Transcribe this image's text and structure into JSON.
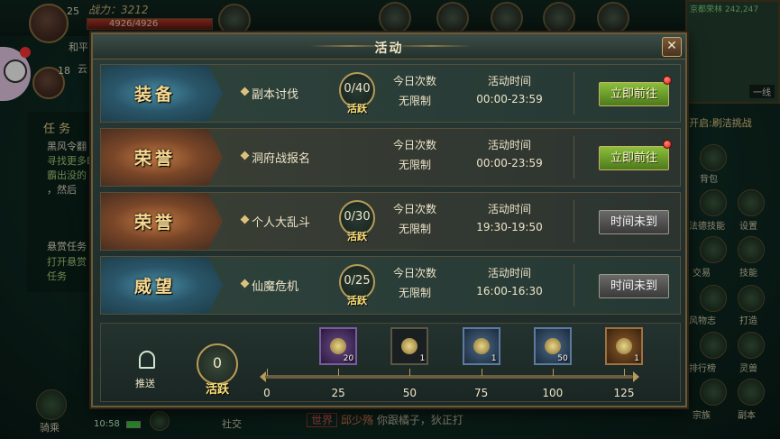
{
  "hud": {
    "player_level": "25",
    "companion_level": "18",
    "power_label": "战力：3212",
    "hp_text": "4926/4926",
    "player_name_partial": "和平",
    "companion_name_partial": "云",
    "minimap_title": "京都荣林 242,247",
    "minimap_line": "一线",
    "task_tab": "任 务",
    "task_1": "黑风令翻",
    "task_2": "寻找更多B",
    "task_3": "霸出没的",
    "task_4": "，然后",
    "task_5": "悬赏任务",
    "task_6": "打开悬赏",
    "task_7": "任务",
    "next_open": "开启:刷洁挑战",
    "side_labels": [
      "背包",
      "法德技能",
      "设置",
      "交易",
      "技能",
      "风物志",
      "打造",
      "排行榜",
      "灵兽",
      "宗族",
      "副本"
    ],
    "bottom_labels": [
      "骑乘",
      "社交"
    ],
    "clock": "10:58",
    "chat_channel": "世界",
    "chat_name": "邱少殇",
    "chat_message": "你跟橘子，狄正打"
  },
  "dialog": {
    "title": "活动",
    "close_label": "✕",
    "col_count_header": "今日次数",
    "col_time_header": "活动时间",
    "activities": [
      {
        "category": "装备",
        "category_color": "blue",
        "name": "副本讨伐",
        "progress": "0/40",
        "progress_tag": "活跃",
        "count": "无限制",
        "time": "00:00-23:59",
        "button": "立即前往",
        "button_state": "go",
        "has_alert": true
      },
      {
        "category": "荣誉",
        "category_color": "orange",
        "name": "洞府战报名",
        "progress": "",
        "progress_tag": "",
        "count": "无限制",
        "time": "00:00-23:59",
        "button": "立即前往",
        "button_state": "go",
        "has_alert": true
      },
      {
        "category": "荣誉",
        "category_color": "orange",
        "name": "个人大乱斗",
        "progress": "0/30",
        "progress_tag": "活跃",
        "count": "无限制",
        "time": "19:30-19:50",
        "button": "时间未到",
        "button_state": "closed",
        "has_alert": false
      },
      {
        "category": "威望",
        "category_color": "blue",
        "name": "仙魔危机",
        "progress": "0/25",
        "progress_tag": "活跃",
        "count": "无限制",
        "time": "16:00-16:30",
        "button": "时间未到",
        "button_state": "closed",
        "has_alert": false
      }
    ],
    "push_label": "推送",
    "total_active": "0",
    "total_active_tag": "活跃",
    "milestones": [
      "0",
      "25",
      "50",
      "75",
      "100",
      "125"
    ],
    "rewards": [
      {
        "color": "purple",
        "qty": "20",
        "icon": "scroll-icon"
      },
      {
        "color": "dark",
        "qty": "1",
        "icon": "bag-icon"
      },
      {
        "color": "blue",
        "qty": "1",
        "icon": "bag-icon"
      },
      {
        "color": "blue",
        "qty": "50",
        "icon": "orb-icon"
      },
      {
        "color": "orange",
        "qty": "1",
        "icon": "treasure-icon"
      }
    ]
  }
}
